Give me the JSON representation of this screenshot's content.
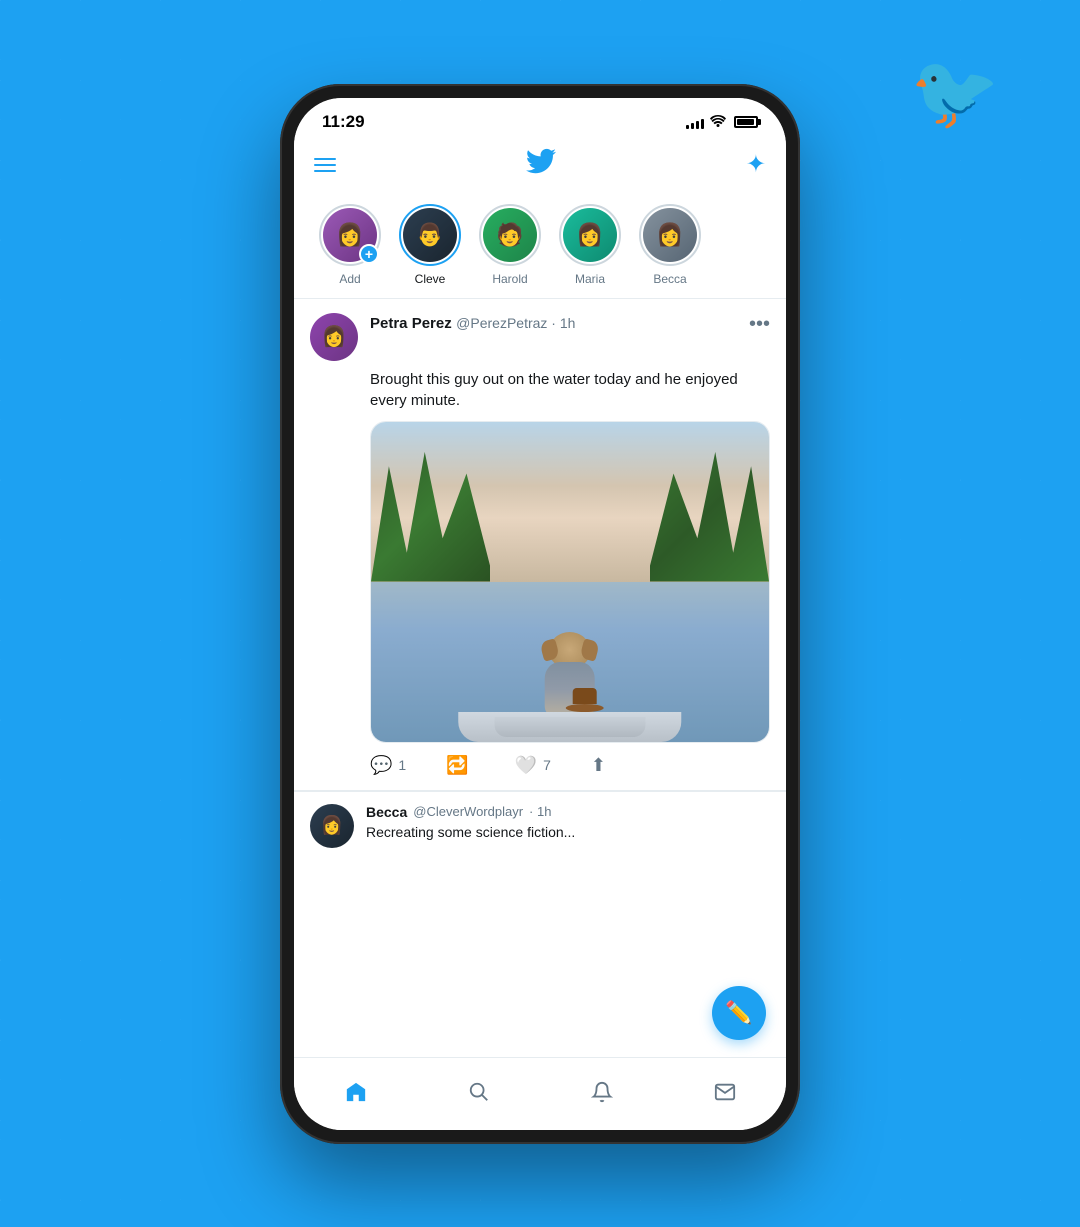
{
  "background": {
    "color": "#1DA1F2"
  },
  "twitter_logo": "🐦",
  "status_bar": {
    "time": "11:29",
    "signal_bars": [
      4,
      6,
      8,
      10,
      12
    ],
    "wifi": "WiFi",
    "battery": "100%"
  },
  "nav": {
    "hamburger_label": "Menu",
    "twitter_bird": "🐦",
    "sparkle_label": "Sparkle"
  },
  "stories": [
    {
      "id": "add",
      "label": "Add",
      "has_story": false,
      "has_add": true,
      "emoji": "👩"
    },
    {
      "id": "cleve",
      "label": "Cleve",
      "has_story": true,
      "has_add": false,
      "emoji": "👨"
    },
    {
      "id": "harold",
      "label": "Harold",
      "has_story": false,
      "has_add": false,
      "emoji": "🧑"
    },
    {
      "id": "maria",
      "label": "Maria",
      "has_story": false,
      "has_add": false,
      "emoji": "👩"
    },
    {
      "id": "becca",
      "label": "Becca",
      "has_story": false,
      "has_add": false,
      "emoji": "👩"
    }
  ],
  "tweet": {
    "author_name": "Petra Perez",
    "author_handle": "@PerezPetraz",
    "author_time": "1h",
    "author_emoji": "👩",
    "text": "Brought this guy out on the water today and he enjoyed every minute.",
    "more_label": "•••",
    "actions": {
      "reply_count": "1",
      "retweet_count": "",
      "like_count": "7",
      "share_label": "Share"
    }
  },
  "fab": {
    "label": "✏",
    "icon": "+"
  },
  "preview_tweet": {
    "author_name": "Becca",
    "author_handle": "@CleverWordplayr",
    "author_time": "1h",
    "text": "Recreating some science fiction...",
    "emoji": "👩"
  },
  "bottom_nav": [
    {
      "id": "home",
      "icon": "🏠",
      "active": true
    },
    {
      "id": "search",
      "icon": "🔍",
      "active": false
    },
    {
      "id": "notifications",
      "icon": "🔔",
      "active": false
    },
    {
      "id": "messages",
      "icon": "✉",
      "active": false
    }
  ]
}
